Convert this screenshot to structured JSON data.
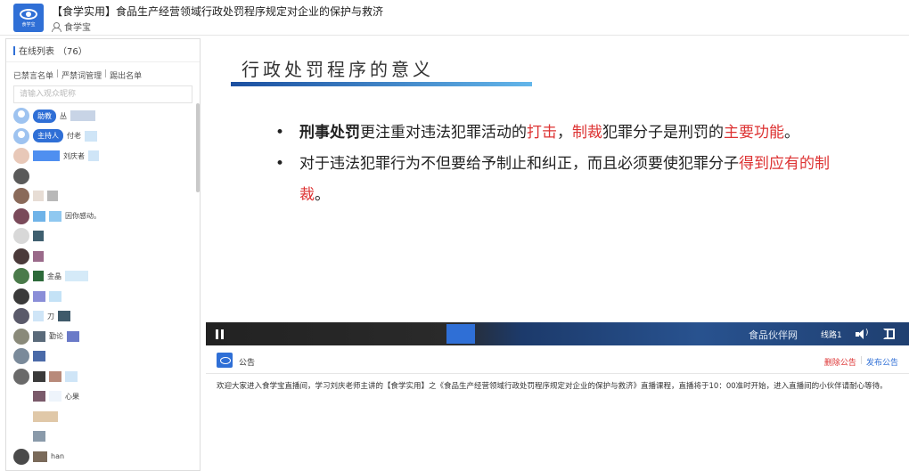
{
  "header": {
    "title": "【食学实用】食品生产经营领域行政处罚程序规定对企业的保护与救济",
    "host": "食学宝",
    "logo_text": "食学宝"
  },
  "sidebar": {
    "online_label": "在线列表",
    "online_count": "（76）",
    "links": [
      "已禁言名单",
      "严禁词管理",
      "踢出名单"
    ],
    "search_placeholder": "请输入观众昵称",
    "members": [
      {
        "role": "助教",
        "name": "丛"
      },
      {
        "role": "主持人",
        "name": "付老"
      },
      {
        "name": "刘庆者"
      },
      {
        "name": ""
      },
      {
        "name": ""
      },
      {
        "name": "因你感动。"
      },
      {
        "name": ""
      },
      {
        "name": ""
      },
      {
        "name": "金晶"
      },
      {
        "name": ""
      },
      {
        "name": "刀"
      },
      {
        "name": "勤论"
      },
      {
        "name": ""
      },
      {
        "name": ""
      },
      {
        "name": "心果"
      },
      {
        "name": ""
      },
      {
        "name": ""
      },
      {
        "name": "han"
      }
    ]
  },
  "slide": {
    "title": "行政处罚程序的意义",
    "bullet1": {
      "part1": "刑事处罚",
      "part2": "更注重对违法犯罪活动的",
      "part3": "打击",
      "part4": "，",
      "part5": "制裁",
      "part6": "犯罪分子是刑罚的",
      "part7": "主要功能",
      "part8": "。"
    },
    "bullet2": {
      "part1": "对于违法犯罪行为不但要给予制止和纠正，而且必须要使犯罪分子",
      "part2": "得到应有的制裁",
      "part3": "。"
    }
  },
  "player": {
    "watermark": "食品伙伴网",
    "route_label": "线路1"
  },
  "notice": {
    "label": "公告",
    "delete_label": "删除公告",
    "publish_label": "发布公告",
    "text": "欢迎大家进入食学宝直播间，学习刘庆老师主讲的【食学实用】之《食品生产经营领域行政处罚程序规定对企业的保护与救济》直播课程，直播将于10：00准时开始，进入直播间的小伙伴请耐心等待。"
  },
  "colors": {
    "brand": "#2f6fd6",
    "accent_red": "#d33333"
  }
}
